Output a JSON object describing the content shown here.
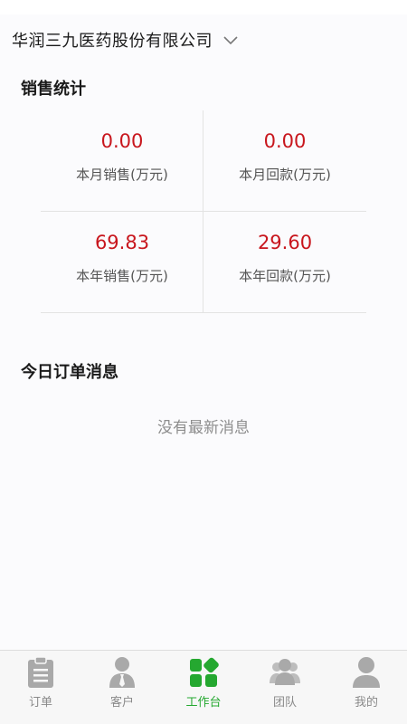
{
  "header": {
    "company_name": "华润三九医药股份有限公司"
  },
  "sales": {
    "title": "销售统计",
    "stats": [
      {
        "value": "0.00",
        "label": "本月销售(万元)"
      },
      {
        "value": "0.00",
        "label": "本月回款(万元)"
      },
      {
        "value": "69.83",
        "label": "本年销售(万元)"
      },
      {
        "value": "29.60",
        "label": "本年回款(万元)"
      }
    ]
  },
  "orders": {
    "title": "今日订单消息",
    "empty_message": "没有最新消息"
  },
  "tabbar": {
    "tabs": [
      {
        "label": "订单",
        "icon": "clipboard-icon"
      },
      {
        "label": "客户",
        "icon": "person-tie-icon"
      },
      {
        "label": "工作台",
        "icon": "workbench-grid-icon",
        "active": true
      },
      {
        "label": "团队",
        "icon": "team-icon"
      },
      {
        "label": "我的",
        "icon": "user-icon"
      }
    ]
  },
  "colors": {
    "accent": "#25a830",
    "value": "#c8161d",
    "inactive_icon": "#a9a9a9"
  }
}
